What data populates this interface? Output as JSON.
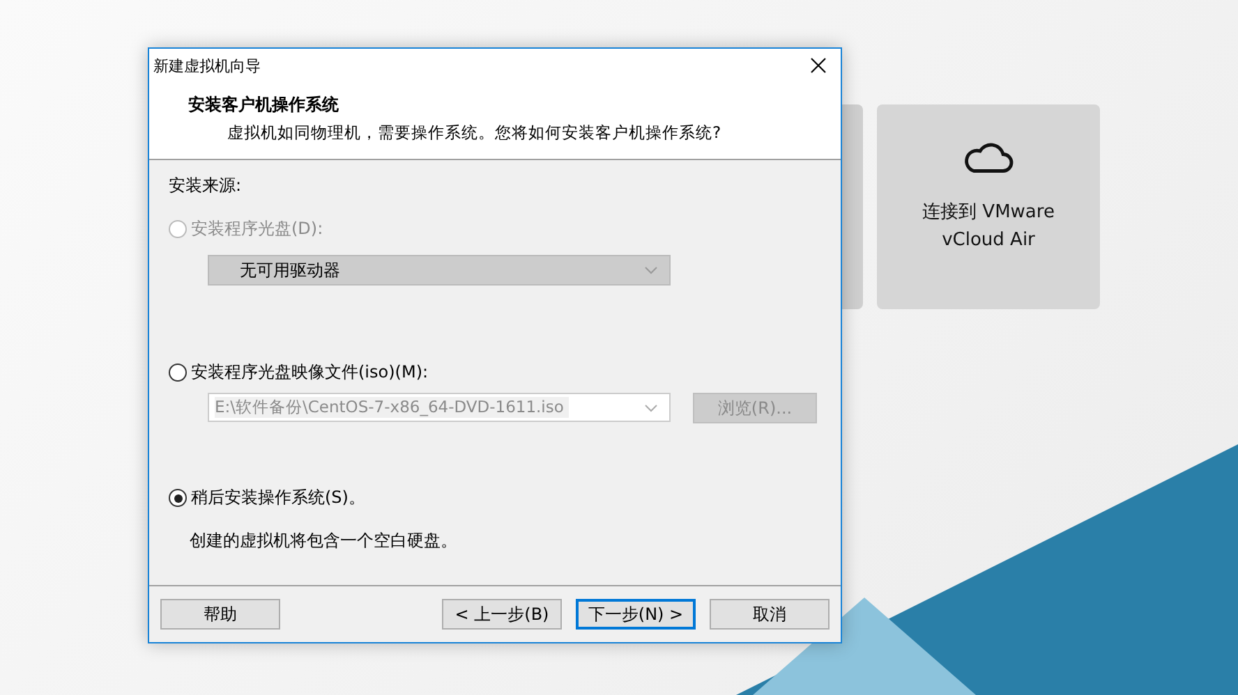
{
  "background": {
    "tiles": [
      {
        "label": "连接到 VMware vCloud Air"
      }
    ]
  },
  "dialog": {
    "title": "新建虚拟机向导",
    "heading": "安装客户机操作系统",
    "subtitle": "虚拟机如同物理机，需要操作系统。您将如何安装客户机操作系统?",
    "section_label": "安装来源:",
    "options": [
      {
        "kind": "disc",
        "label": "安装程序光盘(D):",
        "selected": false,
        "disabled": true,
        "dropdown": "无可用驱动器"
      },
      {
        "kind": "iso",
        "label": "安装程序光盘映像文件(iso)(M):",
        "selected": false,
        "disabled": false,
        "path": "E:\\软件备份\\CentOS-7-x86_64-DVD-1611.iso",
        "path_disabled": true,
        "browse": "浏览(R)...",
        "browse_disabled": true
      },
      {
        "kind": "later",
        "label": "稍后安装操作系统(S)。",
        "selected": true,
        "disabled": false,
        "note": "创建的虚拟机将包含一个空白硬盘。"
      }
    ],
    "buttons": [
      {
        "label": "帮助",
        "default": false
      },
      {
        "label": "< 上一步(B)",
        "default": false
      },
      {
        "label": "下一步(N) >",
        "default": true
      },
      {
        "label": "取消",
        "default": false
      }
    ]
  }
}
